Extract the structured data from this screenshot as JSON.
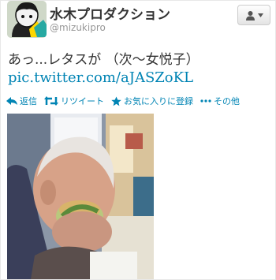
{
  "tweet": {
    "display_name": "水木プロダクション",
    "screen_name": "@mizukipro",
    "text": "あっ...レタスが （次～女悦子）",
    "link": "pic.twitter.com/aJASZoKL"
  },
  "actions": {
    "reply": "返信",
    "retweet": "リツイート",
    "favorite": "お気に入りに登録",
    "more": "その他"
  },
  "colors": {
    "link": "#0084b4",
    "screen_name": "#999999",
    "text": "#333333"
  },
  "icons": {
    "reply": "reply-arrow-icon",
    "retweet": "retweet-icon",
    "favorite": "star-icon",
    "more": "dots-icon",
    "follow": "user-icon"
  }
}
